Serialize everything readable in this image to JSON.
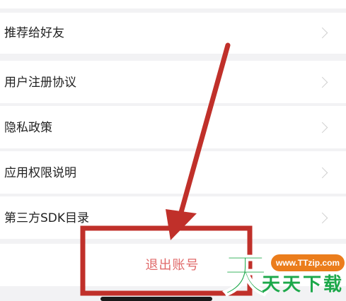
{
  "settings": {
    "items": [
      {
        "label": "推荐给好友"
      },
      {
        "label": "用户注册协议"
      },
      {
        "label": "隐私政策"
      },
      {
        "label": "应用权限说明"
      },
      {
        "label": "第三方SDK目录"
      }
    ],
    "logout_label": "退出账号"
  },
  "watermark": {
    "url": "www.TTzip.com",
    "brand": "天天下载",
    "logo_char": "天",
    "colors": {
      "green": "#1ca84a",
      "orange": "#eb7d1c"
    }
  },
  "annotation": {
    "color": "#c0302a",
    "shapes": [
      "arrow",
      "highlight-box"
    ]
  },
  "colors": {
    "logout_text": "#e06a6a",
    "background": "#f2f2f4"
  }
}
